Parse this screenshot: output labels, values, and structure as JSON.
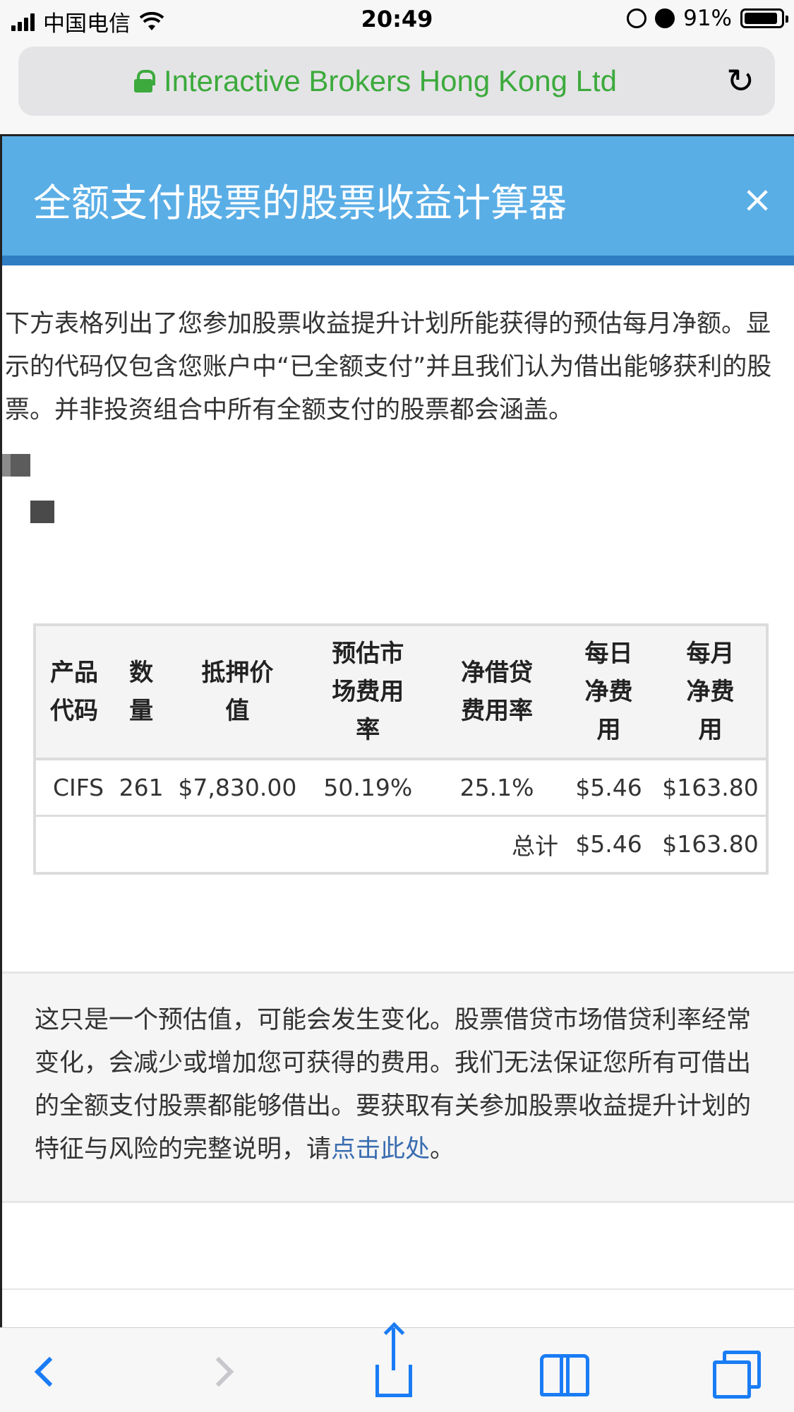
{
  "status_bar": {
    "carrier": "中国电信",
    "time": "20:49",
    "battery": "91%",
    "battery_level": 0.91
  },
  "browser": {
    "url_label": "Interactive Brokers Hong Kong Ltd",
    "reload_icon": "↻"
  },
  "modal": {
    "title": "全额支付股票的股票收益计算器",
    "close_icon": "×",
    "header_color": "#5aaee6",
    "header_bar_color": "#2f7dc2",
    "intro": "下方表格列出了您参加股票收益提升计划所能获得的预估每月净额。显示的代码仅包含您账户中“已全额支付”并且我们认为借出能够获利的股票。并非投资组合中所有全额支付的股票都会涵盖。"
  },
  "table": {
    "headers": [
      "产品代码",
      "数量",
      "抵押价值",
      "预估市场费用率",
      "净借贷费用率",
      "每日净费用",
      "每月净费用"
    ],
    "rows": [
      [
        "CIFS",
        "261",
        "$7,830.00",
        "50.19%",
        "25.1%",
        "$5.46",
        "$163.80"
      ]
    ],
    "total": {
      "label": "总计",
      "daily": "$5.46",
      "monthly": "$163.80"
    }
  },
  "note": {
    "text": "这只是一个预估值，可能会发生变化。股票借贷市场借贷利率经常变化，会减少或增加您可获得的费用。我们无法保证您所有可借出的全额支付股票都能够借出。要获取有关参加股票收益提升计划的特征与风险的完整说明，请",
    "link": "点击此处",
    "suffix": "。",
    "link_color": "#3a6db0"
  },
  "toolbar": {
    "icons": [
      "back-icon",
      "forward-icon",
      "share-icon",
      "bookmarks-icon",
      "tabs-icon"
    ],
    "accent": "#1a7cf5"
  }
}
